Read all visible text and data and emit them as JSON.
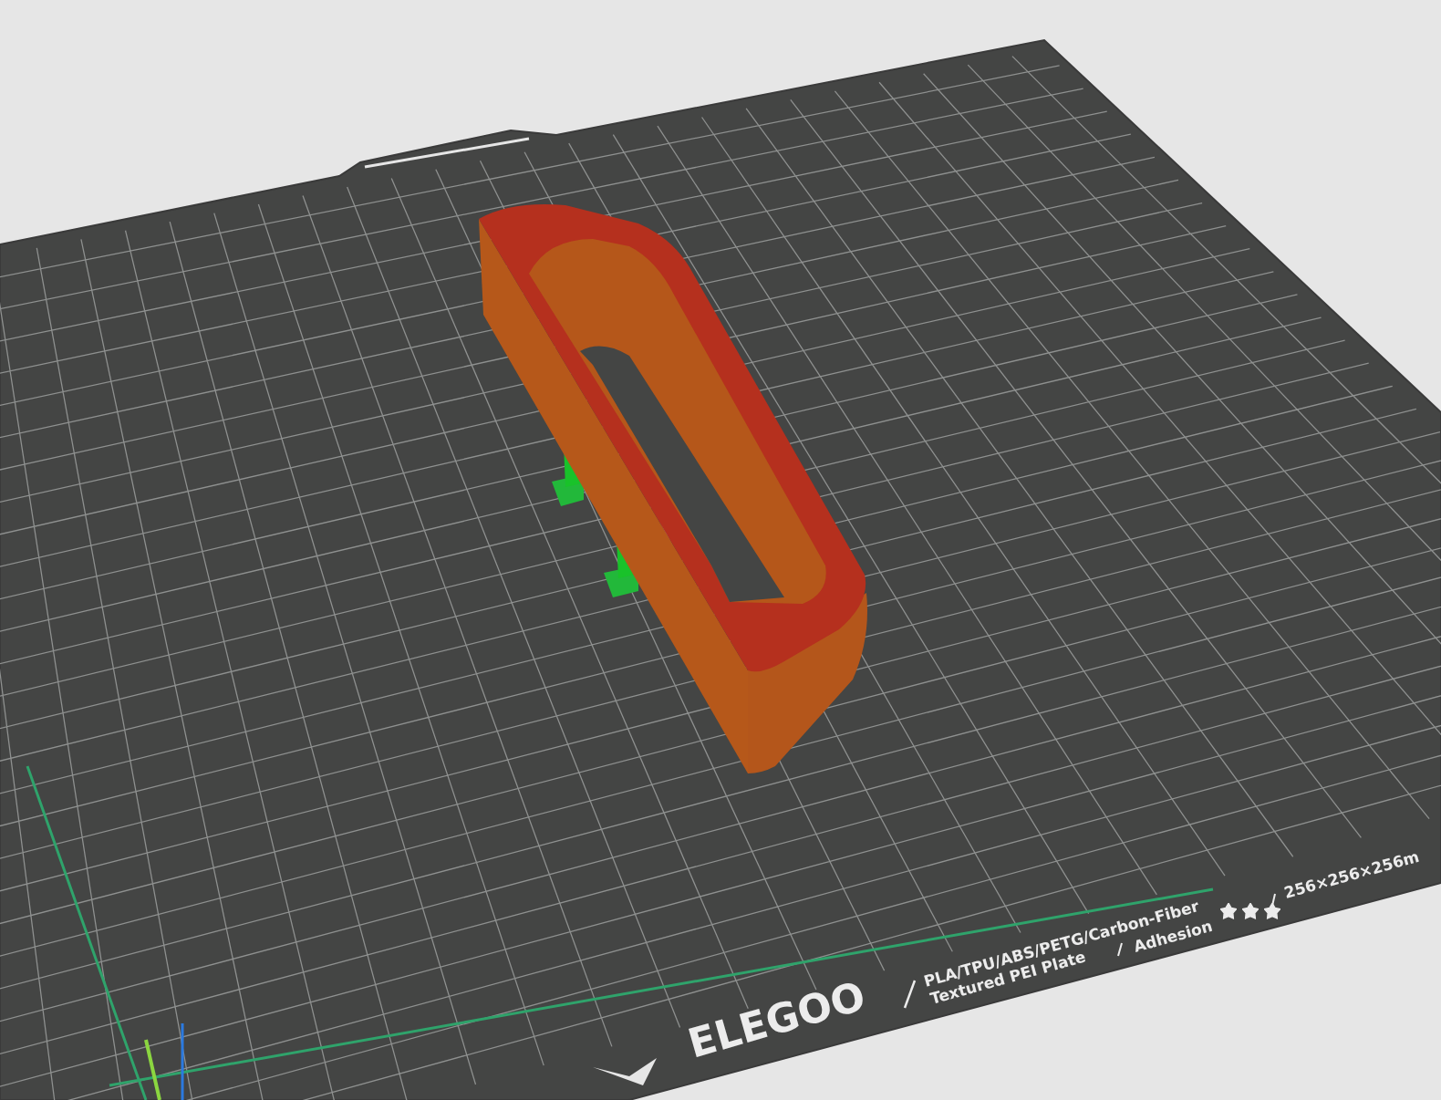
{
  "plate": {
    "logo": "ELEGOO",
    "materials": "PLA/TPU/ABS/PETG/Carbon-Fiber",
    "size": "256×256×256m",
    "surface": "Textured PEI Plate",
    "property": "Adhesion",
    "stars": 3
  }
}
